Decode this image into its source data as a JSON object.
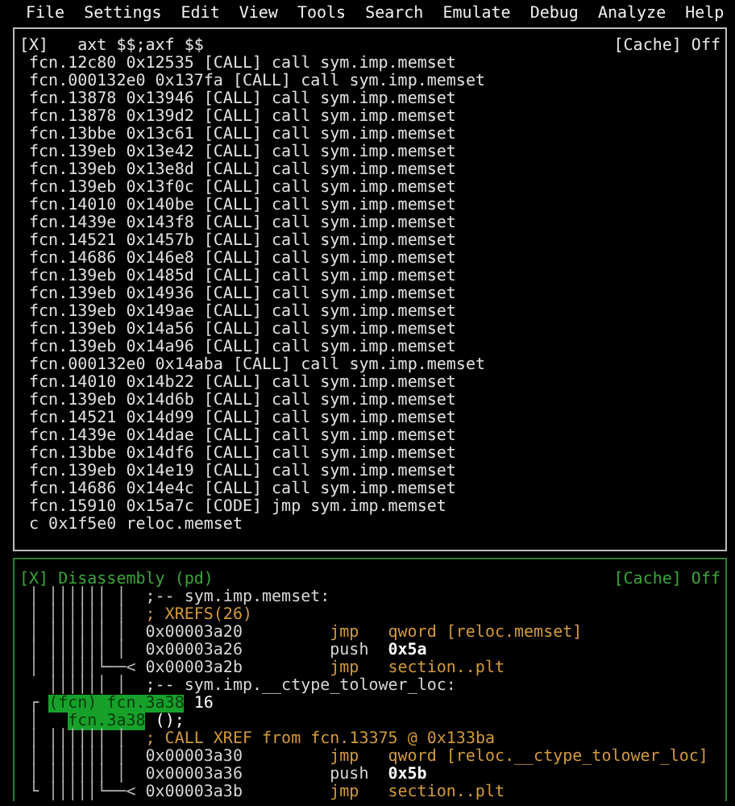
{
  "menu": [
    "File",
    "Settings",
    "Edit",
    "View",
    "Tools",
    "Search",
    "Emulate",
    "Debug",
    "Analyze",
    "Help"
  ],
  "panels": [
    {
      "kind": "xrefs",
      "focused": false,
      "close": "[X]",
      "title": "axt $$;axf $$",
      "cache": "[Cache] Off",
      "lines": [
        " fcn.12c80 0x12535 [CALL] call sym.imp.memset",
        " fcn.000132e0 0x137fa [CALL] call sym.imp.memset",
        " fcn.13878 0x13946 [CALL] call sym.imp.memset",
        " fcn.13878 0x139d2 [CALL] call sym.imp.memset",
        " fcn.13bbe 0x13c61 [CALL] call sym.imp.memset",
        " fcn.139eb 0x13e42 [CALL] call sym.imp.memset",
        " fcn.139eb 0x13e8d [CALL] call sym.imp.memset",
        " fcn.139eb 0x13f0c [CALL] call sym.imp.memset",
        " fcn.14010 0x140be [CALL] call sym.imp.memset",
        " fcn.1439e 0x143f8 [CALL] call sym.imp.memset",
        " fcn.14521 0x1457b [CALL] call sym.imp.memset",
        " fcn.14686 0x146e8 [CALL] call sym.imp.memset",
        " fcn.139eb 0x1485d [CALL] call sym.imp.memset",
        " fcn.139eb 0x14936 [CALL] call sym.imp.memset",
        " fcn.139eb 0x149ae [CALL] call sym.imp.memset",
        " fcn.139eb 0x14a56 [CALL] call sym.imp.memset",
        " fcn.139eb 0x14a96 [CALL] call sym.imp.memset",
        " fcn.000132e0 0x14aba [CALL] call sym.imp.memset",
        " fcn.14010 0x14b22 [CALL] call sym.imp.memset",
        " fcn.139eb 0x14d6b [CALL] call sym.imp.memset",
        " fcn.14521 0x14d99 [CALL] call sym.imp.memset",
        " fcn.1439e 0x14dae [CALL] call sym.imp.memset",
        " fcn.13bbe 0x14df6 [CALL] call sym.imp.memset",
        " fcn.139eb 0x14e19 [CALL] call sym.imp.memset",
        " fcn.14686 0x14e4c [CALL] call sym.imp.memset",
        " fcn.15910 0x15a7c [CODE] jmp sym.imp.memset",
        " c 0x1f5e0 reloc.memset"
      ]
    },
    {
      "kind": "disassembly",
      "focused": true,
      "close": "[X]",
      "title": "Disassembly (pd)",
      "cache": "[Cache] Off",
      "lines": [
        {
          "kind": "label",
          "gutter": " │ ││││││ │",
          "text": ";-- sym.imp.memset:"
        },
        {
          "kind": "comment",
          "gutter": " │ ││││││ │",
          "text": "; XREFS(26)"
        },
        {
          "kind": "instr",
          "gutter": " │ ││││││ │",
          "address": "0x00003a20",
          "mnemonic": "jmp",
          "jump": true,
          "operand": "qword [reloc.memset]",
          "immediate": false
        },
        {
          "kind": "instr",
          "gutter": " │ ││││││ │",
          "address": "0x00003a26",
          "mnemonic": "push",
          "jump": false,
          "operand": "0x5a",
          "immediate": true
        },
        {
          "kind": "instr",
          "gutter": " │ │││││└──<",
          "address": "0x00003a2b",
          "mnemonic": "jmp",
          "jump": true,
          "operand": "section..plt",
          "immediate": false
        },
        {
          "kind": "label",
          "gutter": "   ││││││ │",
          "text": ";-- sym.imp.__ctype_tolower_loc:"
        },
        {
          "kind": "function",
          "gutter": " ┌ ",
          "name": "(fcn) fcn.3a38",
          "suffix": " 16"
        },
        {
          "kind": "function",
          "gutter": " │   ",
          "name": "fcn.3a38",
          "suffix": " ();"
        },
        {
          "kind": "comment",
          "gutter": " │ ││││││ │",
          "text": "; CALL XREF from fcn.13375 @ 0x133ba"
        },
        {
          "kind": "instr",
          "gutter": " │ ││││││ │",
          "address": "0x00003a30",
          "mnemonic": "jmp",
          "jump": true,
          "operand": "qword [reloc.__ctype_tolower_loc]",
          "immediate": false
        },
        {
          "kind": "instr",
          "gutter": " │ ││││││ │",
          "address": "0x00003a36",
          "mnemonic": "push",
          "jump": false,
          "operand": "0x5b",
          "immediate": true
        },
        {
          "kind": "instr",
          "gutter": " └ │││││└──<",
          "address": "0x00003a3b",
          "mnemonic": "jmp",
          "jump": true,
          "operand": "section..plt",
          "immediate": false
        }
      ]
    }
  ]
}
